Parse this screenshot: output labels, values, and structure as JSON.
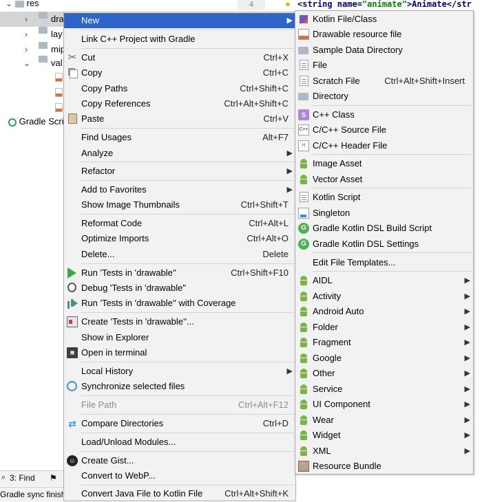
{
  "tree": {
    "items": [
      {
        "label": "res"
      },
      {
        "label": "dra"
      },
      {
        "label": "lay"
      },
      {
        "label": "mip"
      },
      {
        "label": "val"
      }
    ],
    "gradle_label": "Gradle Scri"
  },
  "editor": {
    "line_number": "4",
    "code_prefix": "<string name=",
    "code_value": "\"animate\"",
    "code_suffix": ">Animate</str"
  },
  "bottom": {
    "find_tab": "3: Find",
    "status_text": "Gradle sync finish"
  },
  "context_menu": {
    "new": "New",
    "link_cpp": "Link C++ Project with Gradle",
    "cut": "Cut",
    "cut_sc": "Ctrl+X",
    "copy": "Copy",
    "copy_sc": "Ctrl+C",
    "copy_paths": "Copy Paths",
    "copy_paths_sc": "Ctrl+Shift+C",
    "copy_refs": "Copy References",
    "copy_refs_sc": "Ctrl+Alt+Shift+C",
    "paste": "Paste",
    "paste_sc": "Ctrl+V",
    "find_usages": "Find Usages",
    "find_usages_sc": "Alt+F7",
    "analyze": "Analyze",
    "refactor": "Refactor",
    "add_favorites": "Add to Favorites",
    "show_thumbnails": "Show Image Thumbnails",
    "show_thumbnails_sc": "Ctrl+Shift+T",
    "reformat": "Reformat Code",
    "reformat_sc": "Ctrl+Alt+L",
    "optimize": "Optimize Imports",
    "optimize_sc": "Ctrl+Alt+O",
    "delete": "Delete...",
    "delete_sc": "Delete",
    "run_tests": "Run 'Tests in 'drawable''",
    "run_tests_sc": "Ctrl+Shift+F10",
    "debug_tests": "Debug 'Tests in 'drawable''",
    "run_coverage": "Run 'Tests in 'drawable'' with Coverage",
    "create_tests": "Create 'Tests in 'drawable''...",
    "show_explorer": "Show in Explorer",
    "open_terminal": "Open in terminal",
    "local_history": "Local History",
    "synchronize": "Synchronize selected files",
    "file_path": "File Path",
    "file_path_sc": "Ctrl+Alt+F12",
    "compare_dirs": "Compare Directories",
    "compare_dirs_sc": "Ctrl+D",
    "load_unload": "Load/Unload Modules...",
    "create_gist": "Create Gist...",
    "convert_webp": "Convert to WebP...",
    "convert_kotlin": "Convert Java File to Kotlin File",
    "convert_kotlin_sc": "Ctrl+Alt+Shift+K"
  },
  "new_submenu": {
    "kotlin_file": "Kotlin File/Class",
    "drawable_res": "Drawable resource file",
    "sample_data": "Sample Data Directory",
    "file": "File",
    "scratch": "Scratch File",
    "scratch_sc": "Ctrl+Alt+Shift+Insert",
    "directory": "Directory",
    "cpp_class": "C++ Class",
    "cpp_source": "C/C++ Source File",
    "cpp_header": "C/C++ Header File",
    "image_asset": "Image Asset",
    "vector_asset": "Vector Asset",
    "kotlin_script": "Kotlin Script",
    "singleton": "Singleton",
    "gradle_build": "Gradle Kotlin DSL Build Script",
    "gradle_settings": "Gradle Kotlin DSL Settings",
    "edit_templates": "Edit File Templates...",
    "aidl": "AIDL",
    "activity": "Activity",
    "android_auto": "Android Auto",
    "folder": "Folder",
    "fragment": "Fragment",
    "google": "Google",
    "other": "Other",
    "service": "Service",
    "ui_component": "UI Component",
    "wear": "Wear",
    "widget": "Widget",
    "xml": "XML",
    "resource_bundle": "Resource Bundle"
  },
  "colors": {
    "selection": "#2f65ca",
    "menu_bg": "#f2f2f2",
    "android_green": "#7cb342"
  }
}
